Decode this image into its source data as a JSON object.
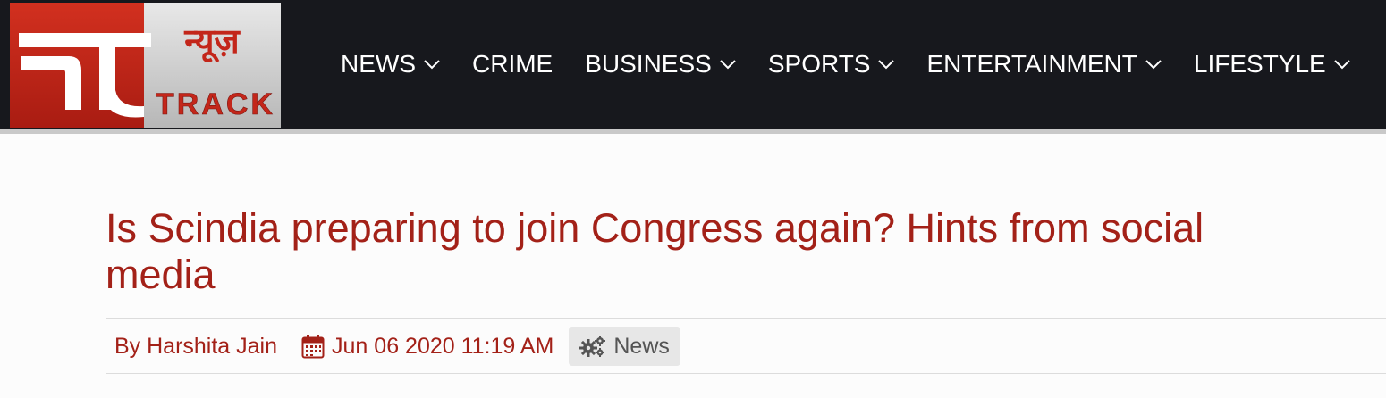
{
  "logo": {
    "hindi_text": "न्यूज़",
    "latin_text": "TRACK",
    "colors": {
      "red": "#c3261a",
      "silver": "#c9c9c9"
    }
  },
  "nav": {
    "items": [
      {
        "label": "NEWS",
        "has_dropdown": true
      },
      {
        "label": "CRIME",
        "has_dropdown": false
      },
      {
        "label": "BUSINESS",
        "has_dropdown": true
      },
      {
        "label": "SPORTS",
        "has_dropdown": true
      },
      {
        "label": "ENTERTAINMENT",
        "has_dropdown": true
      },
      {
        "label": "LIFESTYLE",
        "has_dropdown": true
      }
    ]
  },
  "article": {
    "title": "Is Scindia preparing to join Congress again? Hints from social media",
    "author": "By Harshita Jain",
    "date": "Jun 06 2020 11:19 AM",
    "category": "News"
  },
  "icons": {
    "chevron": "chevron-down-icon",
    "calendar": "calendar-icon",
    "category": "cogs-icon"
  },
  "colors": {
    "header_bg": "#17181d",
    "accent": "#a32118",
    "category_bg": "#e7e7e7"
  }
}
